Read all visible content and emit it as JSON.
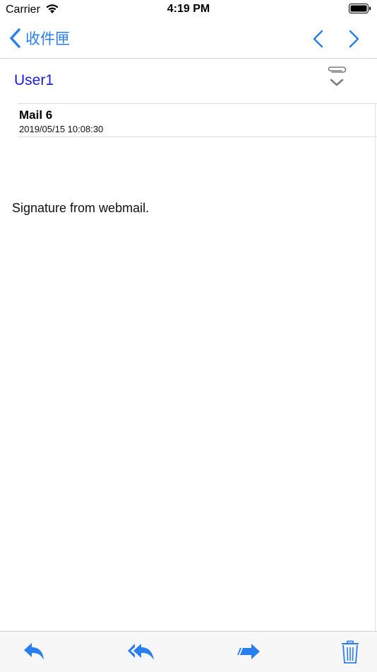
{
  "status_bar": {
    "carrier": "Carrier",
    "time": "4:19 PM"
  },
  "nav": {
    "back_label": "收件匣"
  },
  "message": {
    "sender": "User1",
    "subject": "Mail 6",
    "date": "2019/05/15 10:08:30",
    "body": "Signature from webmail."
  },
  "colors": {
    "accent": "#2a7ff0",
    "sender": "#1d1dd9"
  },
  "icons": {
    "back": "chevron-left-icon",
    "prev": "chevron-left-icon",
    "next": "chevron-right-icon",
    "attachment": "paperclip-icon",
    "expand": "chevron-down-icon",
    "reply": "reply-icon",
    "reply_all": "reply-all-icon",
    "forward": "forward-icon",
    "trash": "trash-icon"
  }
}
